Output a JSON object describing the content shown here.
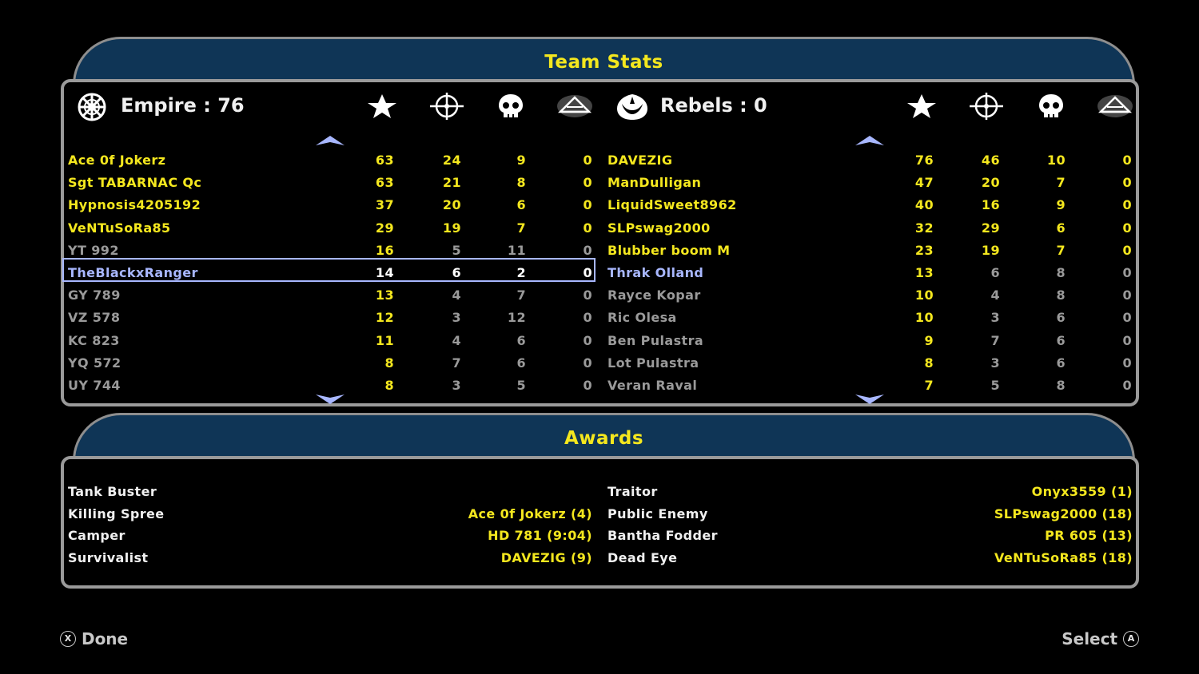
{
  "team_stats_title": "Team Stats",
  "awards_title": "Awards",
  "empire": {
    "title": "Empire : 76",
    "players": [
      {
        "name": "Ace 0f Jokerz",
        "v": [
          "63",
          "24",
          "9",
          "0"
        ],
        "style": "yellow"
      },
      {
        "name": "Sgt TABARNAC Qc",
        "v": [
          "63",
          "21",
          "8",
          "0"
        ],
        "style": "yellow"
      },
      {
        "name": "Hypnosis4205192",
        "v": [
          "37",
          "20",
          "6",
          "0"
        ],
        "style": "yellow"
      },
      {
        "name": "VeNTuSoRa85",
        "v": [
          "29",
          "19",
          "7",
          "0"
        ],
        "style": "yellow"
      },
      {
        "name": "YT 992",
        "v": [
          "16",
          "5",
          "11",
          "0"
        ],
        "style": "gray"
      },
      {
        "name": "TheBlackxRanger",
        "v": [
          "14",
          "6",
          "2",
          "0"
        ],
        "style": "selected"
      },
      {
        "name": "GY 789",
        "v": [
          "13",
          "4",
          "7",
          "0"
        ],
        "style": "gray"
      },
      {
        "name": "VZ 578",
        "v": [
          "12",
          "3",
          "12",
          "0"
        ],
        "style": "gray"
      },
      {
        "name": "KC 823",
        "v": [
          "11",
          "4",
          "6",
          "0"
        ],
        "style": "gray"
      },
      {
        "name": "YQ 572",
        "v": [
          "8",
          "7",
          "6",
          "0"
        ],
        "style": "gray"
      },
      {
        "name": "UY 744",
        "v": [
          "8",
          "3",
          "5",
          "0"
        ],
        "style": "gray"
      }
    ]
  },
  "rebels": {
    "title": "Rebels : 0",
    "players": [
      {
        "name": "DAVEZIG",
        "v": [
          "76",
          "46",
          "10",
          "0"
        ],
        "style": "yellow"
      },
      {
        "name": "ManDulligan",
        "v": [
          "47",
          "20",
          "7",
          "0"
        ],
        "style": "yellow"
      },
      {
        "name": "LiquidSweet8962",
        "v": [
          "40",
          "16",
          "9",
          "0"
        ],
        "style": "yellow"
      },
      {
        "name": "SLPswag2000",
        "v": [
          "32",
          "29",
          "6",
          "0"
        ],
        "style": "yellow"
      },
      {
        "name": "Blubber boom M",
        "v": [
          "23",
          "19",
          "7",
          "0"
        ],
        "style": "yellow"
      },
      {
        "name": "Thrak Olland",
        "v": [
          "13",
          "6",
          "8",
          "0"
        ],
        "style": "blue"
      },
      {
        "name": "Rayce Kopar",
        "v": [
          "10",
          "4",
          "8",
          "0"
        ],
        "style": "gray"
      },
      {
        "name": "Ric Olesa",
        "v": [
          "10",
          "3",
          "6",
          "0"
        ],
        "style": "gray"
      },
      {
        "name": "Ben Pulastra",
        "v": [
          "9",
          "7",
          "6",
          "0"
        ],
        "style": "gray"
      },
      {
        "name": "Lot Pulastra",
        "v": [
          "8",
          "3",
          "6",
          "0"
        ],
        "style": "gray"
      },
      {
        "name": "Veran Raval",
        "v": [
          "7",
          "5",
          "8",
          "0"
        ],
        "style": "gray"
      }
    ]
  },
  "awards_left": [
    {
      "name": "Tank Buster",
      "value": ""
    },
    {
      "name": "Killing Spree",
      "value": "Ace 0f Jokerz (4)"
    },
    {
      "name": "Camper",
      "value": "HD 781 (9:04)"
    },
    {
      "name": "Survivalist",
      "value": "DAVEZIG (9)"
    }
  ],
  "awards_right": [
    {
      "name": "Traitor",
      "value": "Onyx3559 (1)"
    },
    {
      "name": "Public Enemy",
      "value": "SLPswag2000 (18)"
    },
    {
      "name": "Bantha Fodder",
      "value": "PR 605 (13)"
    },
    {
      "name": "Dead Eye",
      "value": "VeNTuSoRa85 (18)"
    }
  ],
  "footer": {
    "done_button_glyph": "X",
    "done_label": "Done",
    "select_label": "Select",
    "select_button_glyph": "A"
  },
  "colors": {
    "accent_yellow": "#f4e71e",
    "header_blue": "#0f3556",
    "selected_blue": "#a8b7ff",
    "muted_gray": "#9a9a9a"
  },
  "icons": {
    "empire_emblem": "empire-emblem-icon",
    "rebel_emblem": "rebel-emblem-icon",
    "columns": [
      "star-icon",
      "crosshair-icon",
      "skull-icon",
      "vehicle-icon"
    ]
  }
}
